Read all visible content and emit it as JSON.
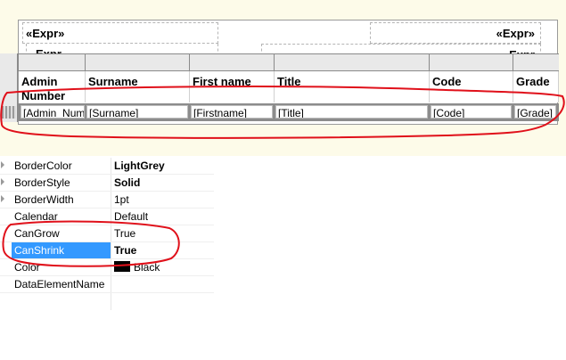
{
  "report": {
    "header_left_expr": "«Expr»",
    "header_right_expr": "«Expr»",
    "partial_left_text": "Expr",
    "partial_right_text": "Expr"
  },
  "table": {
    "headers": [
      "Admin Number",
      "Surname",
      "First name",
      "Title",
      "Code",
      "Grade"
    ],
    "detail": [
      "[Admin_Num",
      "[Surname]",
      "[Firstname]",
      "[Title]",
      "[Code]",
      "[Grade]"
    ]
  },
  "properties": [
    {
      "name": "BorderColor",
      "value": "LightGrey",
      "bold": true,
      "expandable": true
    },
    {
      "name": "BorderStyle",
      "value": "Solid",
      "bold": true,
      "expandable": true
    },
    {
      "name": "BorderWidth",
      "value": "1pt",
      "bold": false,
      "expandable": true
    },
    {
      "name": "Calendar",
      "value": "Default",
      "bold": false,
      "expandable": false
    },
    {
      "name": "CanGrow",
      "value": "True",
      "bold": false,
      "expandable": false
    },
    {
      "name": "CanShrink",
      "value": "True",
      "bold": true,
      "expandable": false,
      "selected": true
    },
    {
      "name": "Color",
      "value": "Black",
      "bold": false,
      "expandable": false,
      "swatch": "#000000"
    },
    {
      "name": "DataElementName",
      "value": "",
      "bold": false,
      "expandable": false
    }
  ],
  "colors": {
    "annotation": "#e0101a",
    "selection": "#3399ff",
    "design_surface": "#fdfbe9"
  }
}
